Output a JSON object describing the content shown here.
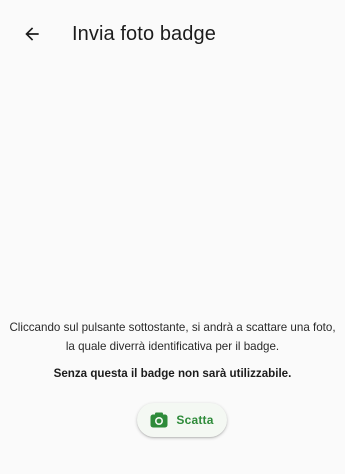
{
  "header": {
    "back_icon": "arrow-left-icon",
    "title": "Invia foto badge"
  },
  "main": {
    "description": "Cliccando sul pulsante sottostante, si andrà a scattare una foto, la quale diverrà identificativa per il badge.",
    "warning": "Senza questa il badge non sarà utilizzabile.",
    "action_button": {
      "icon": "camera-icon",
      "label": "Scatta"
    }
  },
  "colors": {
    "background": "#fafafa",
    "accent": "#2e8b3a",
    "button_background": "#f4f8f3",
    "text": "#1c1c1c"
  }
}
